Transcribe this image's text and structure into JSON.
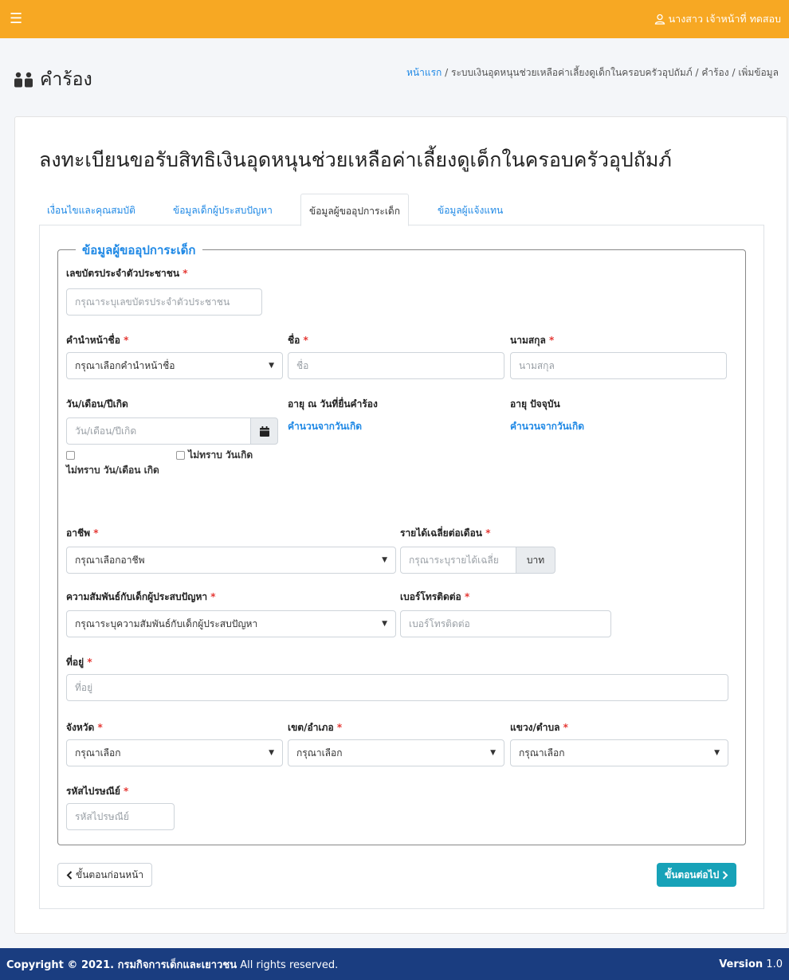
{
  "topbar": {
    "user_name": "นางสาว เจ้าหน้าที่ ทดสอบ",
    "color": "#f7a823"
  },
  "header": {
    "page_title": "คำร้อง",
    "breadcrumb": {
      "home": "หน้าแรก",
      "system": "ระบบเงินอุดหนุนช่วยเหลือค่าเลี้ยงดูเด็กในครอบครัวอุปถัมภ์",
      "section": "คำร้อง",
      "current": "เพิ่มข้อมูล",
      "separator": "/"
    }
  },
  "form": {
    "title": "ลงทะเบียนขอรับสิทธิเงินอุดหนุนช่วยเหลือค่าเลี้ยงดูเด็กในครอบครัวอุปถัมภ์",
    "tabs": [
      {
        "label": "เงื่อนไขและคุณสมบัติ",
        "active": false
      },
      {
        "label": "ข้อมูลเด็กผู้ประสบปัญหา",
        "active": false
      },
      {
        "label": "ข้อมูลผู้ขออุปการะเด็ก",
        "active": true
      },
      {
        "label": "ข้อมูลผู้แจ้งแทน",
        "active": false
      }
    ],
    "legend": "ข้อมูลผู้ขออุปการะเด็ก",
    "required_mark": "*",
    "id_card": {
      "label": "เลขบัตรประจำตัวประชาชน",
      "placeholder": "กรุณาระบุเลขบัตรประจำตัวประชาชน"
    },
    "prefix": {
      "label": "คำนำหน้าชื่อ",
      "value": "กรุณาเลือกคำนำหน้าชื่อ"
    },
    "first_name": {
      "label": "ชื่อ",
      "placeholder": "ชื่อ"
    },
    "last_name": {
      "label": "นามสกุล",
      "placeholder": "นามสกุล"
    },
    "birth_date": {
      "label": "วัน/เดือน/ปีเกิด",
      "placeholder": "วัน/เดือน/ปีเกิด"
    },
    "age_at_request": {
      "label": "อายุ ณ วันที่ยื่นคำร้อง",
      "value": "คำนวนจากวันเกิด"
    },
    "age_current": {
      "label": "อายุ ปัจจุบัน",
      "value": "คำนวนจากวันเกิด"
    },
    "unknown_day_month": "ไม่ทราบ วัน/เดือน เกิด",
    "unknown_birthdate": "ไม่ทราบ วันเกิด",
    "occupation": {
      "label": "อาชีพ",
      "value": "กรุณาเลือกอาชีพ"
    },
    "income": {
      "label": "รายได้เฉลี่ยต่อเดือน",
      "placeholder": "กรุณาระบุรายได้เฉลี่ย",
      "unit": "บาท"
    },
    "relationship": {
      "label": "ความสัมพันธ์กับเด็กผู้ประสบปัญหา",
      "value": "กรุณาระบุความสัมพันธ์กับเด็กผู้ประสบปัญหา"
    },
    "phone": {
      "label": "เบอร์โทรติดต่อ",
      "placeholder": "เบอร์โทรติดต่อ"
    },
    "address": {
      "label": "ที่อยู่",
      "placeholder": "ที่อยู่"
    },
    "province": {
      "label": "จังหวัด",
      "value": "กรุณาเลือก"
    },
    "district": {
      "label": "เขต/อำเภอ",
      "value": "กรุณาเลือก"
    },
    "subdistrict": {
      "label": "แขวง/ตำบล",
      "value": "กรุณาเลือก"
    },
    "postal_code": {
      "label": "รหัสไปรษณีย์",
      "placeholder": "รหัสไปรษณีย์"
    },
    "prev_button": "ขั้นตอนก่อนหน้า",
    "next_button": "ขั้นตอนต่อไป"
  },
  "footer": {
    "copyright_prefix": "Copyright © 2021. กรมกิจการเด็กและเยาวชน",
    "rights": "All rights reserved.",
    "version_label": "Version",
    "version_number": "1.0",
    "color": "#1a3d80"
  },
  "icons": [
    "hamburger-icon",
    "user-icon",
    "users-icon",
    "calendar-icon",
    "chevron-left-icon",
    "chevron-right-icon"
  ]
}
